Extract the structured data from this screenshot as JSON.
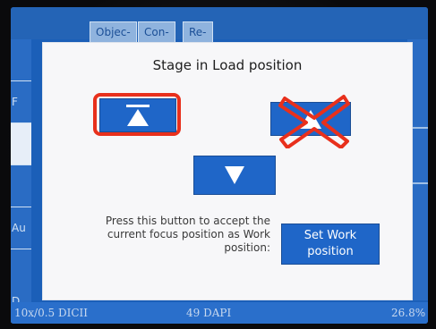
{
  "dialog": {
    "title": "Stage in Load position",
    "description": "Press this button to accept the current focus position as Work position:",
    "set_work_button": "Set Work\nposition"
  },
  "tabs": [
    "Objec-",
    "Con-",
    "Re-"
  ],
  "sidebar_left": [
    "F",
    "Au",
    "D"
  ],
  "status": {
    "objective": "10x/0.5 DICII",
    "filter": "49 DAPI",
    "zoom": "26.8%"
  },
  "icons": {
    "move_to_load_position": "arrow-up-to-line-icon",
    "move_up_disabled": "arrow-up-icon",
    "crossed_out_mark": "red-x-icon",
    "move_down": "arrow-down-icon"
  },
  "colors": {
    "screen_blue": "#1b5fb8",
    "button_blue": "#1f66c8",
    "dialog_bg": "#f7f7f9",
    "highlight_red": "#e8301c"
  }
}
